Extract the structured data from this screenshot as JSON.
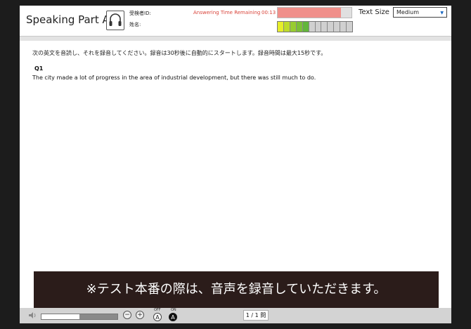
{
  "header": {
    "title": "Speaking Part A",
    "examinee_id_label": "受検者ID:",
    "name_label": "姓名:",
    "time_label": "Answering Time Remaining",
    "time_value": "00:13",
    "time_remaining_fraction": 0.86,
    "level_meter_lit_segments": 5,
    "level_meter_total_segments": 12,
    "text_size_label": "Text Size",
    "text_size_value": "Medium"
  },
  "content": {
    "instruction": "次の英文を音読し、それを録音してください。録音は30秒後に自動的にスタートします。録音時間は最大15秒です。",
    "question_label": "Q1",
    "sentence": "The city made a lot of progress in the area of industrial development, but there was still much to do."
  },
  "notice": "※テスト本番の際は、音声を録音していただきます。",
  "footer": {
    "volume_level_fraction": 0.5,
    "minus": "−",
    "plus": "+",
    "toggle_off_label": "OFF",
    "toggle_on_label": "ON",
    "toggle_glyph": "A",
    "page_indicator": "1 / 1 問"
  },
  "colors": {
    "time_text": "#d9443a",
    "time_bar": "#f08f8a",
    "notice_bg": "#2b1c1a",
    "meter_colors": [
      "#e6ee2a",
      "#bedc2a",
      "#98cc30",
      "#7cc035",
      "#62b63a"
    ]
  }
}
